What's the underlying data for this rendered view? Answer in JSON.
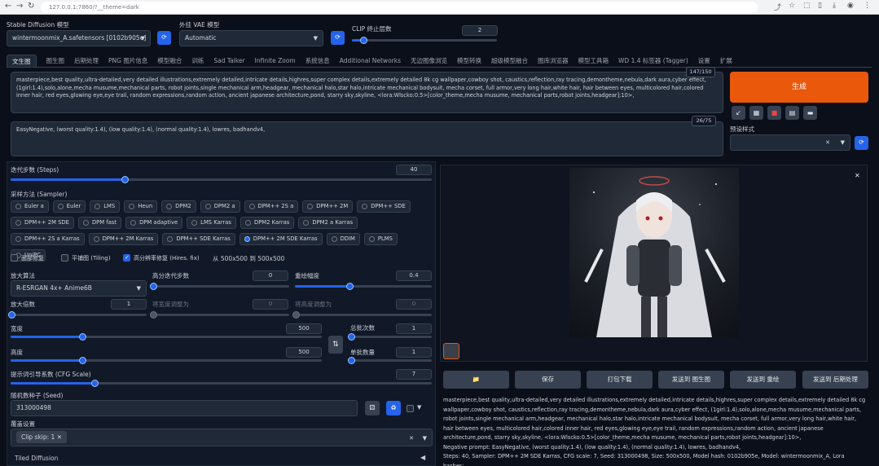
{
  "browser": {
    "url": "127.0.0.1:7860/?__theme=dark"
  },
  "top": {
    "model_label": "Stable Diffusion 模型",
    "model_value": "wintermoonmix_A.safetensors [0102b905e]",
    "vae_label": "外挂 VAE 模型",
    "vae_value": "Automatic",
    "clip_label": "CLIP 终止层数",
    "clip_value": "2",
    "clip_fraction": 0.08
  },
  "tabs": [
    "文生图",
    "图生图",
    "后期处理",
    "PNG 图片信息",
    "模型融合",
    "训练",
    "Sad Talker",
    "Infinite Zoom",
    "系统信息",
    "Additional Networks",
    "无边图像浏览",
    "模型转换",
    "超级模型融合",
    "图库浏览器",
    "模型工具箱",
    "WD 1.4 标签器 (Tagger)",
    "设置",
    "扩展"
  ],
  "prompt": {
    "positive": "masterpiece,best quality,ultra-detailed,very detailed illustrations,extremely detailed,intricate details,highres,super complex details,extremely detailed 8k cg wallpaper,cowboy shot, caustics,reflection,ray tracing,demontheme,nebula,dark aura,cyber effect, (1girl:1.4),solo,alone,mecha musume,mechanical parts, robot joints,single mechanical arm,headgear, mechanical halo,star halo,intricate mechanical bodysuit, mecha corset, full armor,very long hair,white hair, hair between eyes, multicolored hair,colored inner hair, red eyes,glowing eye,eye trail, random expressions,random action, ancient japanese architecture,pond, starry sky,skyline, <lora:Wlscko:0.5>[color_theme,mecha musume, mechanical parts,robot joints,headgear]:10>,",
    "positive_count": "147/150",
    "negative": "EasyNegative, (worst quality:1.4), (low quality:1.4), (normal quality:1.4), lowres, badhandv4,",
    "negative_count": "26/75"
  },
  "right_controls": {
    "generate_label": "生成",
    "style_label": "预设样式",
    "tools": [
      "↙",
      "▦",
      "■",
      "▤",
      "▬"
    ]
  },
  "steps": {
    "label": "迭代步数 (Steps)",
    "value": "40",
    "fraction": 0.27
  },
  "sampler": {
    "label": "采样方法 (Sampler)",
    "options": [
      "Euler a",
      "Euler",
      "LMS",
      "Heun",
      "DPM2",
      "DPM2 a",
      "DPM++ 2S a",
      "DPM++ 2M",
      "DPM++ SDE",
      "DPM++ 2M SDE",
      "DPM fast",
      "DPM adaptive",
      "LMS Karras",
      "DPM2 Karras",
      "DPM2 a Karras",
      "DPM++ 2S a Karras",
      "DPM++ 2M Karras",
      "DPM++ SDE Karras",
      "DPM++ 2M SDE Karras",
      "DDIM",
      "PLMS",
      "UniPC"
    ],
    "selected": "DPM++ 2M SDE Karras"
  },
  "checks": {
    "face": "面部修复",
    "tiling": "平铺图 (Tiling)",
    "hires": "高分辨率修复 (Hires. fix)",
    "hires_note": "从 500x500 到 500x500"
  },
  "hires": {
    "upscaler_label": "放大算法",
    "upscaler_value": "R-ESRGAN 4x+ Anime6B",
    "steps_label": "高分迭代步数",
    "steps_value": "0",
    "denoise_label": "重绘幅度",
    "denoise_value": "0.4",
    "denoise_fraction": 0.4,
    "scale_label": "放大倍数",
    "scale_value": "1",
    "width_label": "将宽度调整为",
    "width_value": "0",
    "height_label": "将高度调整为",
    "height_value": "0"
  },
  "size": {
    "width_label": "宽度",
    "width_value": "500",
    "height_label": "高度",
    "height_value": "500",
    "swap_icon": "⇅",
    "batch_count_label": "总批次数",
    "batch_count_value": "1",
    "batch_size_label": "单批数量",
    "batch_size_value": "1"
  },
  "cfg": {
    "label": "提示词引导系数 (CFG Scale)",
    "value": "7",
    "fraction": 0.2
  },
  "seed": {
    "label": "随机数种子 (Seed)",
    "value": "313000498"
  },
  "script_section": {
    "label": "覆盖设置",
    "clip_skip_chip": "Clip skip: 1",
    "tiled": "Tiled Diffusion"
  },
  "output": {
    "buttons": [
      "📁",
      "保存",
      "打包下载",
      "发送到 图生图",
      "发送到 重绘",
      "发送到 后期处理"
    ],
    "info": "masterpiece,best quality,ultra-detailed,very detailed illustrations,extremely detailed,intricate details,highres,super complex details,extremely detailed 8k cg wallpaper,cowboy shot, caustics,reflection,ray tracing,demontheme,nebula,dark aura,cyber effect, (1girl:1.4),solo,alone,mecha musume,mechanical parts, robot joints,single mechanical arm,headgear, mechanical halo,star halo,intricate mechanical bodysuit, mecha corset, full armor,very long hair,white hair, hair between eyes, multicolored hair,colored inner hair, red eyes,glowing eye,eye trail, random expressions,random action, ancient japanese architecture,pond, starry sky,skyline, <lora:Wlscko:0.5>[color_theme,mecha musume, mechanical parts,robot joints,headgear]:10>,",
    "negative": "Negative prompt: EasyNegative, (worst quality:1.4), (low quality:1.4), (normal quality:1.4), lowres, badhandv4,",
    "params": "Steps: 40, Sampler: DPM++ 2M SDE Karras, CFG scale: 7, Seed: 313000498, Size: 500x500, Model hash: 0102b905e, Model: wintermoonmix_A, Lora hashes:"
  },
  "colors": {
    "accent": "#2563eb",
    "generate": "#ea580c",
    "bg": "#0b0f19"
  }
}
